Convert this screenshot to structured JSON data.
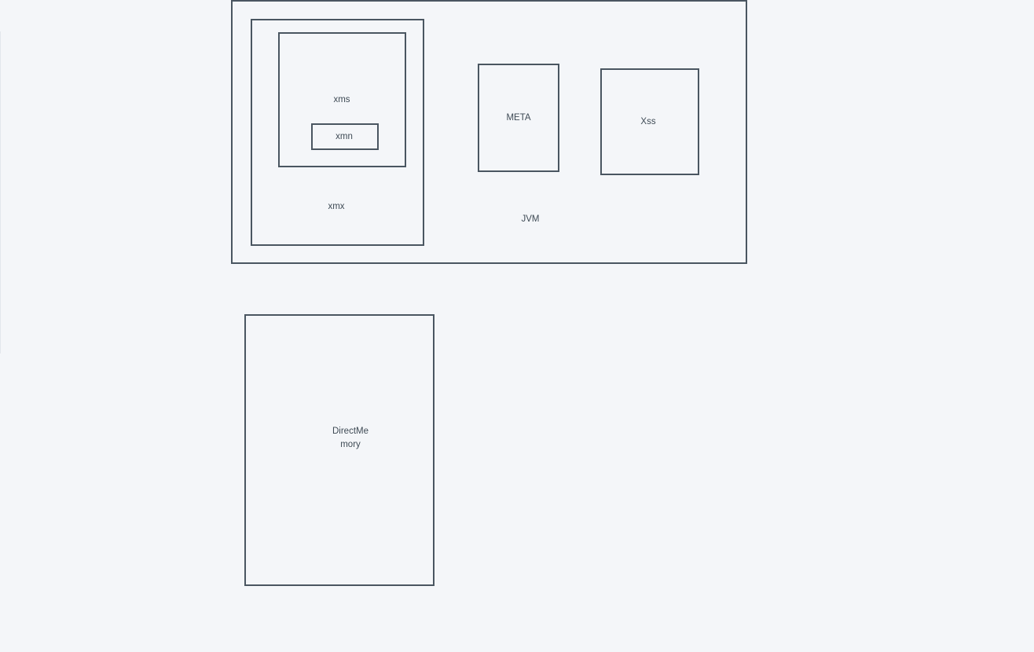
{
  "diagram": {
    "jvm": {
      "label": "JVM"
    },
    "xmx": {
      "label": "xmx"
    },
    "xms": {
      "label": "xms"
    },
    "xmn": {
      "label": "xmn"
    },
    "meta": {
      "label": "META"
    },
    "xss": {
      "label": "Xss"
    },
    "direct_memory": {
      "label_line1": "DirectMe",
      "label_line2": "mory"
    }
  },
  "colors": {
    "background": "#f4f6f9",
    "stroke": "#4a5661",
    "text": "#3e4a55"
  }
}
